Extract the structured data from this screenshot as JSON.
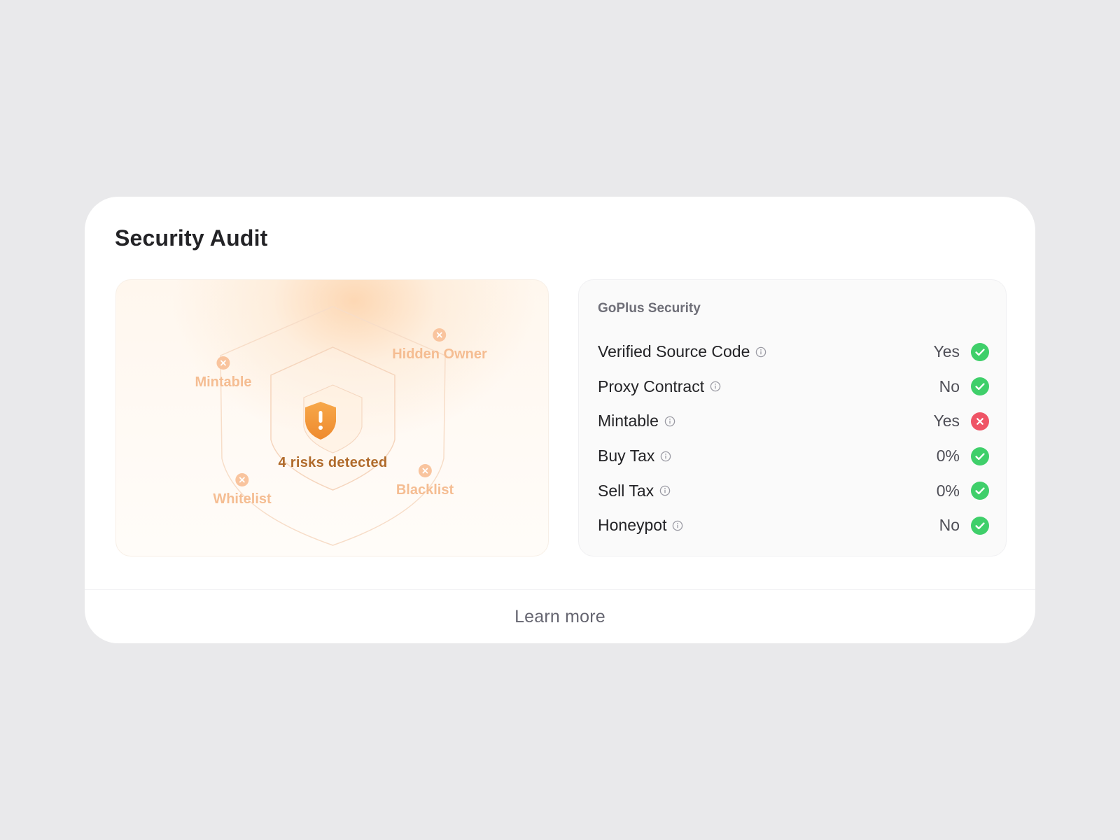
{
  "card": {
    "title": "Security Audit"
  },
  "risk_panel": {
    "summary": "4 risks detected",
    "risks": [
      {
        "label": "Mintable",
        "icon": "x-circle-icon"
      },
      {
        "label": "Hidden Owner",
        "icon": "x-circle-icon"
      },
      {
        "label": "Whitelist",
        "icon": "x-circle-icon"
      },
      {
        "label": "Blacklist",
        "icon": "x-circle-icon"
      }
    ],
    "center_icon": "shield-warning-icon"
  },
  "security_panel": {
    "provider": "GoPlus Security",
    "rows": [
      {
        "label": "Verified Source Code",
        "value": "Yes",
        "status": "pass"
      },
      {
        "label": "Proxy Contract",
        "value": "No",
        "status": "pass"
      },
      {
        "label": "Mintable",
        "value": "Yes",
        "status": "fail"
      },
      {
        "label": "Buy Tax",
        "value": "0%",
        "status": "pass"
      },
      {
        "label": "Sell Tax",
        "value": "0%",
        "status": "pass"
      },
      {
        "label": "Honeypot",
        "value": "No",
        "status": "pass"
      }
    ]
  },
  "footer": {
    "learn_more": "Learn more"
  },
  "colors": {
    "pass": "#3fcf6a",
    "fail": "#ef5466",
    "risk_accent": "#f39a3a",
    "risk_text": "#b06a2a"
  }
}
